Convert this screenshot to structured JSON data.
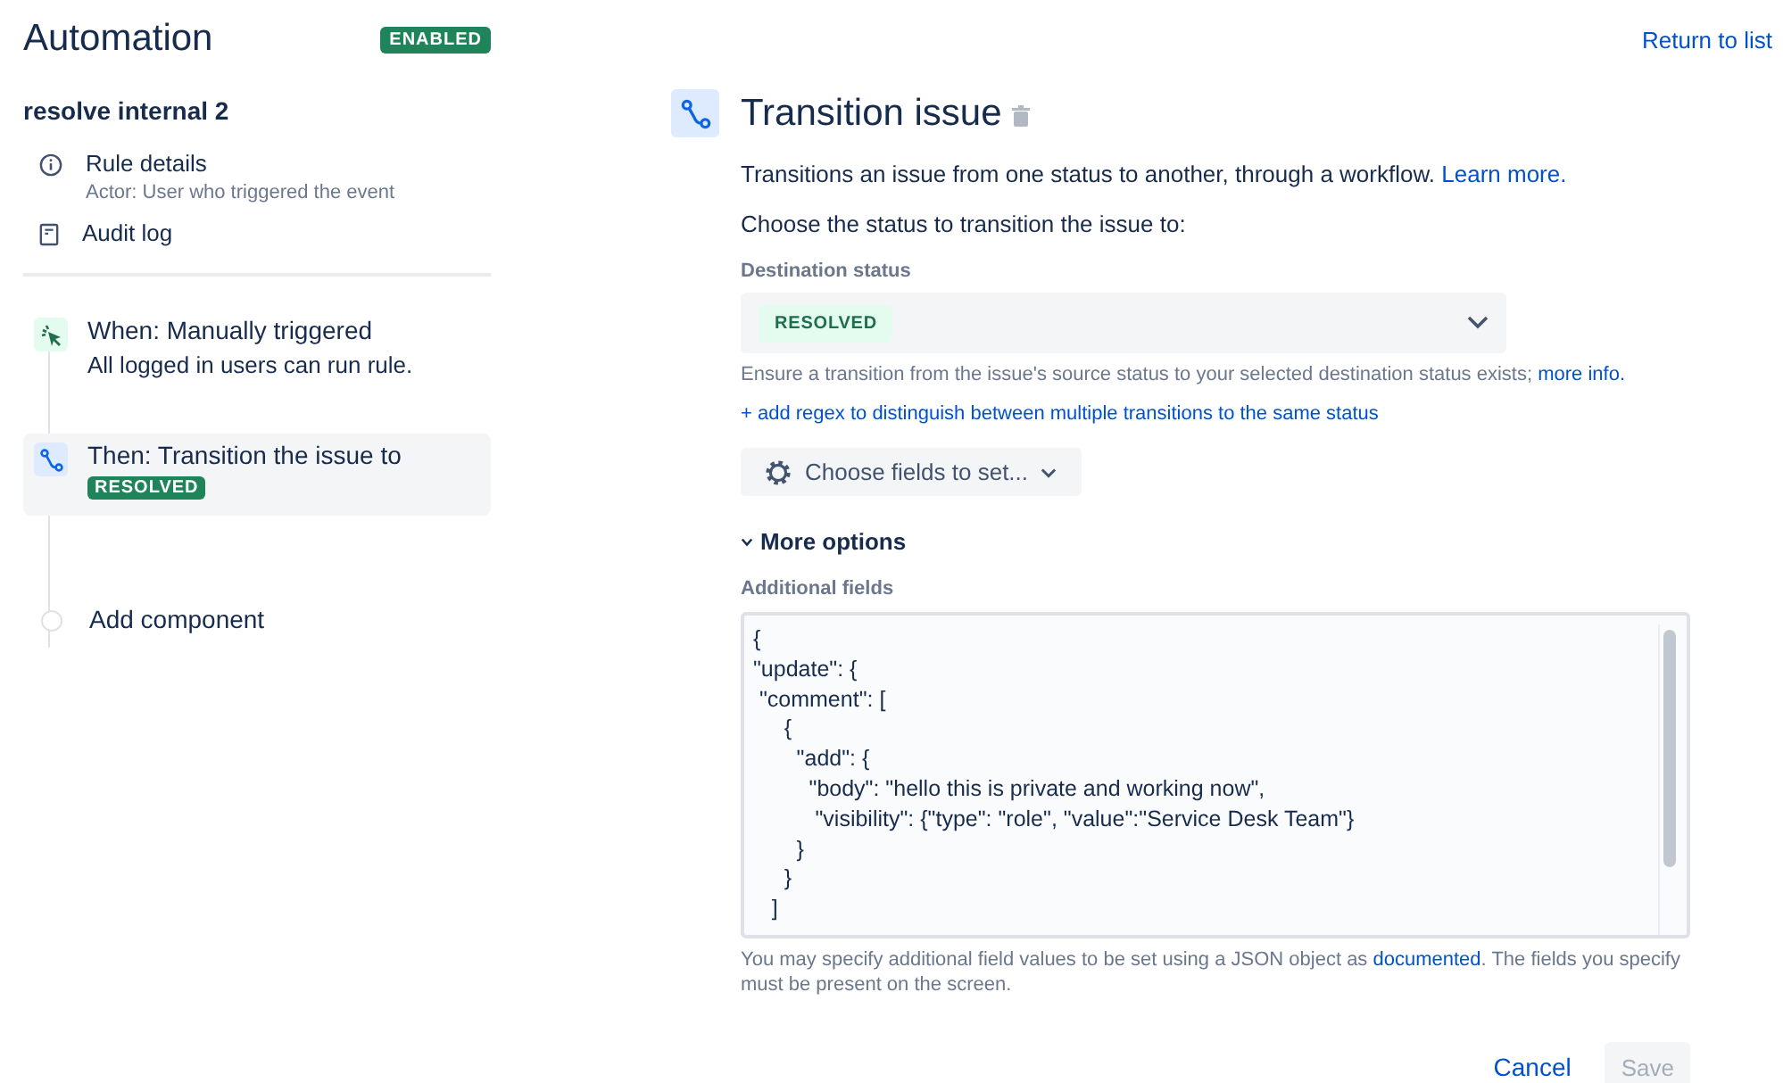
{
  "header": {
    "title": "Automation",
    "status_badge": "ENABLED",
    "return_link": "Return to list"
  },
  "sidebar": {
    "rule_name": "resolve internal 2",
    "items": [
      {
        "kind": "info",
        "label": "Rule details",
        "sublabel": "Actor: User who triggered the event"
      },
      {
        "kind": "log",
        "label": "Audit log"
      }
    ],
    "steps": [
      {
        "kind": "trigger",
        "label": "When: Manually triggered",
        "detail": "All logged in users can run rule.",
        "selected": false
      },
      {
        "kind": "action",
        "label": "Then: Transition the issue to",
        "badge": "RESOLVED",
        "selected": true
      },
      {
        "kind": "add",
        "label": "Add component",
        "selected": false
      }
    ]
  },
  "panel": {
    "title": "Transition issue",
    "description": {
      "text": "Transitions an issue from one status to another, through a workflow.",
      "link": "Learn more."
    },
    "prompt": "Choose the status to transition the issue to:",
    "destination": {
      "label": "Destination status",
      "value": "RESOLVED",
      "help": "Ensure a transition from the issue's source status to your selected destination status exists;",
      "help_link": "more info."
    },
    "regex_link": "+ add regex to distinguish between multiple transitions to the same status",
    "fields_button": "Choose fields to set...",
    "more_options": {
      "label": "More options",
      "expanded": true
    },
    "additional": {
      "label": "Additional fields",
      "lines": [
        "{",
        "\"update\": {",
        " \"comment\": [",
        "     {",
        "       \"add\": {",
        "         \"body\": \"hello this is private and working now\",",
        "          \"visibility\": {\"type\": \"role\", \"value\":\"Service Desk Team\"}",
        "       }",
        "     }",
        "   ]"
      ],
      "help_before": "You may specify additional field values to be set using a JSON object as",
      "help_link": "documented",
      "help_after": ". The fields you specify must be present on the screen."
    },
    "buttons": [
      {
        "label": "Cancel",
        "kind": "link",
        "disabled": false
      },
      {
        "label": "Save",
        "kind": "primary",
        "disabled": true
      }
    ]
  }
}
